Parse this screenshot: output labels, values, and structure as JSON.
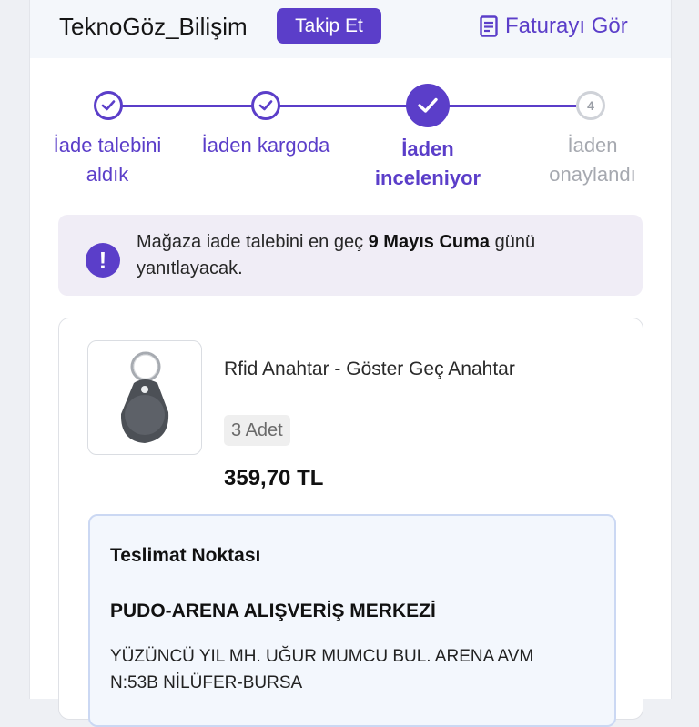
{
  "header": {
    "store_name": "TeknoGöz_Bilişim",
    "follow_label": "Takip Et",
    "invoice_label": "Faturayı Gör"
  },
  "stepper": {
    "steps": [
      {
        "label": "İade talebini aldık",
        "state": "done"
      },
      {
        "label": "İaden kargoda",
        "state": "done"
      },
      {
        "label": "İaden inceleniyor",
        "state": "active"
      },
      {
        "label": "İaden onaylandı",
        "state": "todo",
        "number": "4"
      }
    ]
  },
  "notice": {
    "text_before": "Mağaza iade talebini en geç ",
    "date": "9 Mayıs Cuma",
    "text_after": " günü yanıtlayacak."
  },
  "product": {
    "name": "Rfid Anahtar - Göster Geç Anahtar",
    "quantity": "3 Adet",
    "price": "359,70 TL"
  },
  "delivery": {
    "title": "Teslimat Noktası",
    "place": "PUDO-ARENA ALIŞVERİŞ MERKEZİ",
    "address": "YÜZÜNCÜ YIL MH.  UĞUR MUMCU BUL.  ARENA AVM\nN:53B NİLÜFER-BURSA"
  },
  "colors": {
    "accent": "#5b3ec9",
    "inactive": "#cfd2d8",
    "notice_bg": "#f0edf6",
    "delivery_bg": "#f3f7fd"
  }
}
